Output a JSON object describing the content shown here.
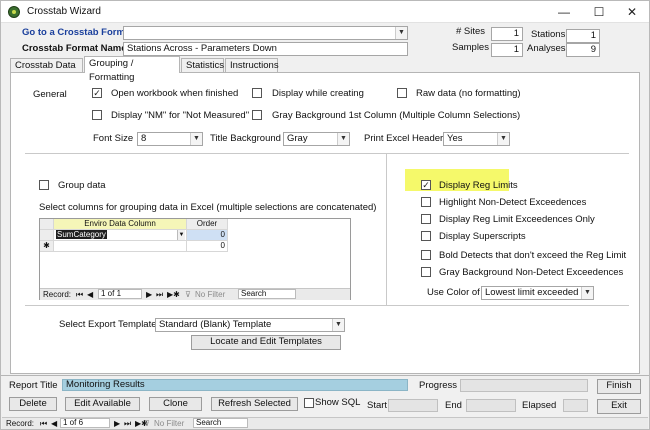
{
  "window": {
    "title": "Crosstab Wizard",
    "minimize": "—",
    "maximize": "☐",
    "close": "✕"
  },
  "header": {
    "goto_label": "Go to a Crosstab Format",
    "goto_value": "",
    "format_name_label": "Crosstab Format Name",
    "format_name_value": "Stations Across - Parameters Down",
    "sites_label": "# Sites",
    "sites_value": "1",
    "stations_label": "Stations",
    "stations_value": "1",
    "samples_label": "Samples",
    "samples_value": "1",
    "analyses_label": "Analyses",
    "analyses_value": "9"
  },
  "tabs": [
    {
      "label": "Crosstab Data"
    },
    {
      "label": "Grouping / Formatting"
    },
    {
      "label": "Statistics"
    },
    {
      "label": "Instructions"
    }
  ],
  "general": {
    "label": "General",
    "open_workbook": {
      "label": "Open workbook when finished",
      "checked": true
    },
    "display_while_creating": {
      "label": "Display while creating",
      "checked": false
    },
    "raw_data": {
      "label": "Raw data (no formatting)",
      "checked": false
    },
    "display_nm": {
      "label": "Display \"NM\" for \"Not Measured\"",
      "checked": false
    },
    "gray_bg": {
      "label": "Gray Background 1st Column (Multiple Column Selections)",
      "checked": false
    },
    "font_size_label": "Font Size",
    "font_size_value": "8",
    "title_bg_label": "Title Background",
    "title_bg_value": "Gray",
    "print_header_label": "Print Excel Header",
    "print_header_value": "Yes"
  },
  "grouping": {
    "group_data": {
      "label": "Group data",
      "checked": false
    },
    "columns_label": "Select columns for grouping data in Excel (multiple selections are concatenated)",
    "grid": {
      "col1_header": "Enviro Data Column",
      "col2_header": "Order",
      "rows": [
        {
          "column": "SumCategory",
          "order": "0"
        },
        {
          "column": "",
          "order": "0"
        }
      ],
      "nav": {
        "record_label": "Record:",
        "position": "1 of 1",
        "no_filter": "No Filter",
        "search": "Search"
      }
    }
  },
  "reg": {
    "display_reg_limits": {
      "label": "Display Reg Limits",
      "checked": true
    },
    "highlight_nd": {
      "label": "Highlight Non-Detect Exceedences",
      "checked": false
    },
    "reg_exceed_only": {
      "label": "Display Reg Limit Exceedences Only",
      "checked": false
    },
    "superscripts": {
      "label": "Display Superscripts",
      "checked": false
    },
    "bold_detects": {
      "label": "Bold Detects that don't exceed the Reg Limit",
      "checked": false
    },
    "gray_nd": {
      "label": "Gray Background Non-Detect Exceedences",
      "checked": false
    },
    "use_color_label": "Use Color of",
    "use_color_value": "Lowest limit exceeded"
  },
  "export": {
    "template_label": "Select Export Template",
    "template_value": "Standard (Blank) Template",
    "locate_button": "Locate and Edit Templates"
  },
  "footer": {
    "report_title_label": "Report Title",
    "report_title_value": "Monitoring Results",
    "progress_label": "Progress",
    "delete_button": "Delete",
    "edit_available_button": "Edit Available",
    "clone_button": "Clone",
    "refresh_button": "Refresh Selected",
    "show_sql": {
      "label": "Show SQL",
      "checked": false
    },
    "start_label": "Start",
    "end_label": "End",
    "elapsed_label": "Elapsed",
    "finish_button": "Finish",
    "exit_button": "Exit"
  },
  "record_nav": {
    "record_label": "Record:",
    "position": "1 of 6",
    "no_filter": "No Filter",
    "search": "Search"
  },
  "colors": {
    "highlight": "#f5f96a",
    "report_title_bg": "#a5cfe0",
    "link_blue": "#1a3f9c",
    "selected_cell": "#cfe0f4"
  }
}
